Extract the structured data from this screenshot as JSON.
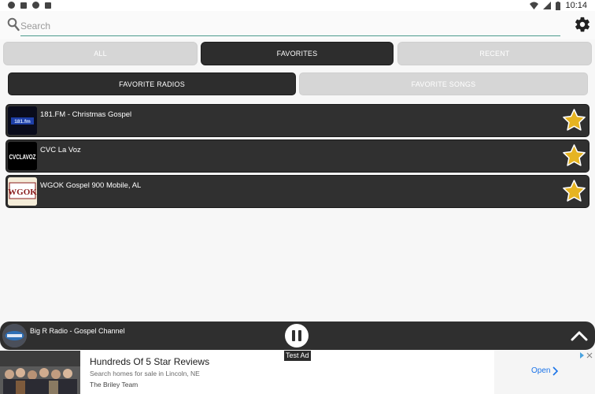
{
  "status_bar": {
    "time": "10:14"
  },
  "search": {
    "placeholder": "Search",
    "value": ""
  },
  "tabs": [
    {
      "label": "ALL",
      "active": false
    },
    {
      "label": "FAVORITES",
      "active": true
    },
    {
      "label": "RECENT",
      "active": false
    }
  ],
  "subtabs": [
    {
      "label": "FAVORITE RADIOS",
      "active": true
    },
    {
      "label": "FAVORITE SONGS",
      "active": false
    }
  ],
  "radios": [
    {
      "name": "181.FM - Christmas Gospel",
      "logo_text": "181.fm"
    },
    {
      "name": "CVC La Voz",
      "logo_text": "CVCLAVOZ"
    },
    {
      "name": "WGOK Gospel 900 Mobile, AL",
      "logo_text": "WGOK"
    }
  ],
  "player": {
    "title": "Big R Radio - Gospel Channel"
  },
  "ad": {
    "test_label": "Test Ad",
    "headline": "Hundreds Of 5 Star Reviews",
    "subline": "Search homes for sale in Lincoln, NE",
    "advertiser": "The Briley Team",
    "cta": "Open"
  },
  "colors": {
    "accent": "#4c9a8d",
    "dark": "#2d2d2d",
    "inactive": "#d6d6d6",
    "star": "#e6b422",
    "ad_link": "#1a73e8"
  }
}
